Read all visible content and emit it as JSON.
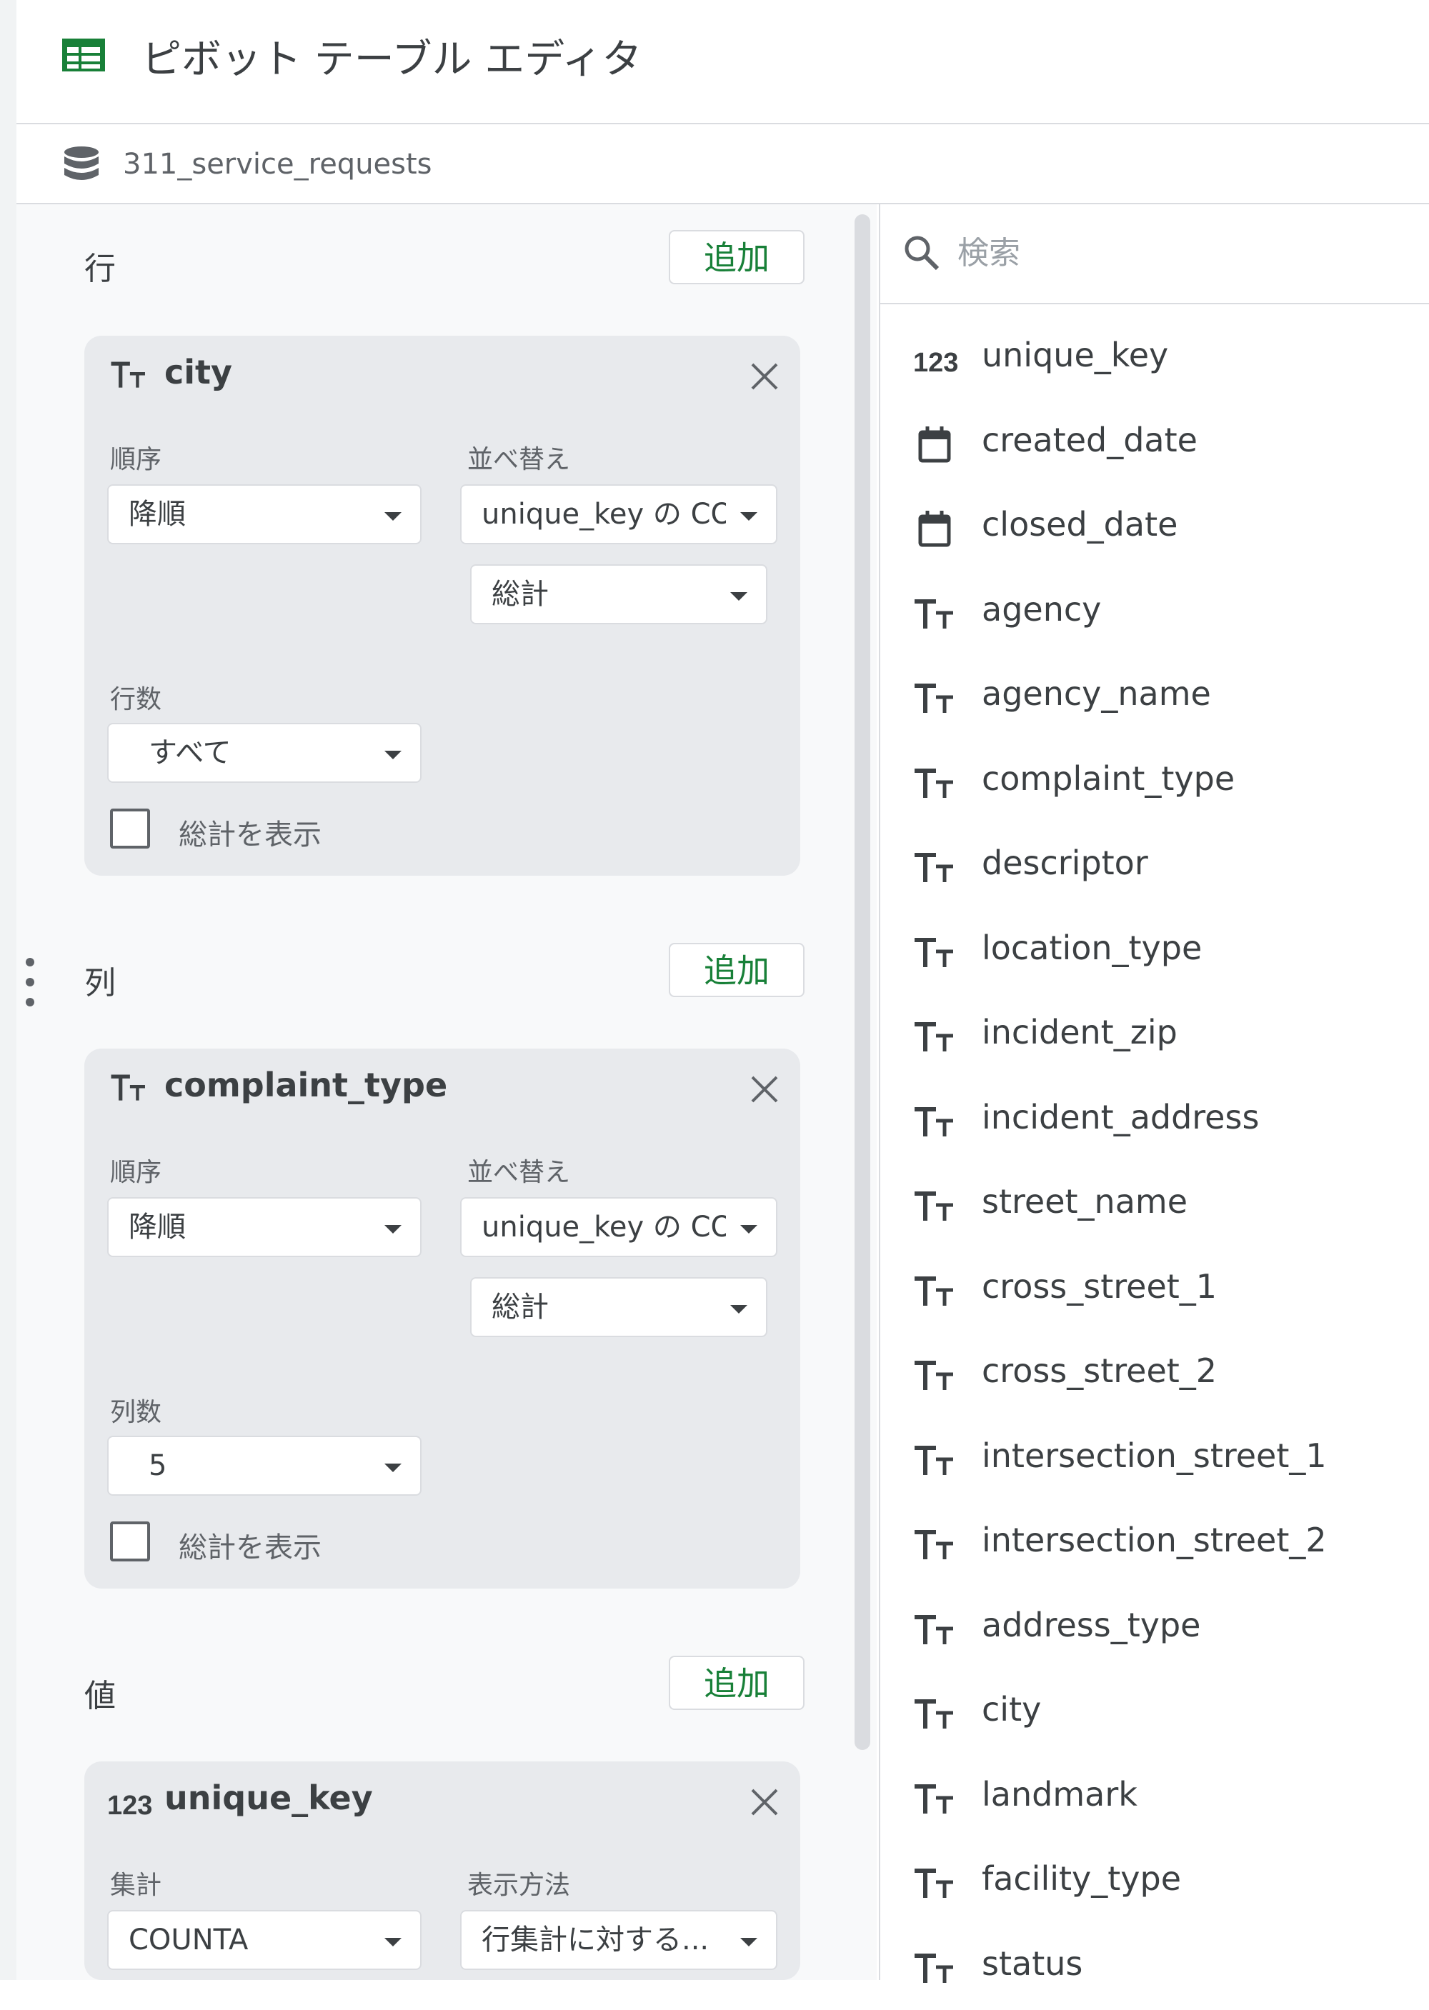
{
  "header": {
    "title": "ピボット テーブル エディタ",
    "icon": "sheets-table-icon"
  },
  "source": {
    "name": "311_service_requests",
    "icon": "database-icon"
  },
  "rows": {
    "title": "行",
    "add_label": "追加",
    "card": {
      "type_icon": "text-type-icon",
      "field_name": "city",
      "order_label": "順序",
      "order_value": "降順",
      "sort_label": "並べ替え",
      "sort_value": "unique_key の CO...",
      "sort_agg_value": "総計",
      "count_label": "行数",
      "count_value": "すべて",
      "show_totals_label": "総計を表示",
      "show_totals_checked": false
    }
  },
  "columns": {
    "title": "列",
    "add_label": "追加",
    "card": {
      "type_icon": "text-type-icon",
      "field_name": "complaint_type",
      "order_label": "順序",
      "order_value": "降順",
      "sort_label": "並べ替え",
      "sort_value": "unique_key の CO...",
      "sort_agg_value": "総計",
      "count_label": "列数",
      "count_value": "5",
      "show_totals_label": "総計を表示",
      "show_totals_checked": false
    }
  },
  "values": {
    "title": "値",
    "add_label": "追加",
    "card": {
      "type_icon": "number-type-icon",
      "field_name": "unique_key",
      "agg_label": "集計",
      "agg_value": "COUNTA",
      "display_label": "表示方法",
      "display_value": "行集計に対する..."
    }
  },
  "field_list": {
    "search_placeholder": "検索",
    "fields": [
      {
        "name": "unique_key",
        "type": "number"
      },
      {
        "name": "created_date",
        "type": "date"
      },
      {
        "name": "closed_date",
        "type": "date"
      },
      {
        "name": "agency",
        "type": "text"
      },
      {
        "name": "agency_name",
        "type": "text"
      },
      {
        "name": "complaint_type",
        "type": "text"
      },
      {
        "name": "descriptor",
        "type": "text"
      },
      {
        "name": "location_type",
        "type": "text"
      },
      {
        "name": "incident_zip",
        "type": "text"
      },
      {
        "name": "incident_address",
        "type": "text"
      },
      {
        "name": "street_name",
        "type": "text"
      },
      {
        "name": "cross_street_1",
        "type": "text"
      },
      {
        "name": "cross_street_2",
        "type": "text"
      },
      {
        "name": "intersection_street_1",
        "type": "text"
      },
      {
        "name": "intersection_street_2",
        "type": "text"
      },
      {
        "name": "address_type",
        "type": "text"
      },
      {
        "name": "city",
        "type": "text"
      },
      {
        "name": "landmark",
        "type": "text"
      },
      {
        "name": "facility_type",
        "type": "text"
      },
      {
        "name": "status",
        "type": "text"
      }
    ]
  },
  "colors": {
    "accent_green": "#188038",
    "card_bg": "#e8eaed",
    "panel_bg": "#f8f9fa",
    "border": "#dadce0"
  }
}
